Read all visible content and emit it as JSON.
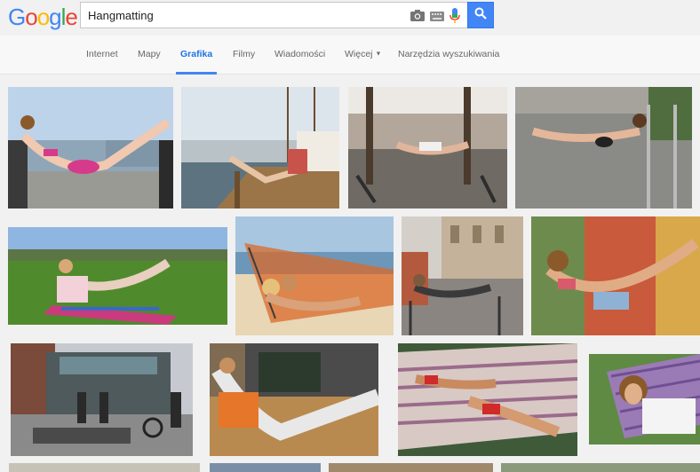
{
  "logo": {
    "letters": [
      "G",
      "o",
      "o",
      "g",
      "l",
      "e"
    ],
    "colors": [
      "#4285f4",
      "#ea4335",
      "#fbbc05",
      "#4285f4",
      "#34a853",
      "#ea4335"
    ]
  },
  "search": {
    "query": "Hangmatting",
    "icons": [
      "camera-icon",
      "keyboard-icon",
      "microphone-icon"
    ],
    "button_icon": "search-icon"
  },
  "tabs": [
    {
      "label": "Internet",
      "active": false
    },
    {
      "label": "Mapy",
      "active": false
    },
    {
      "label": "Grafika",
      "active": true
    },
    {
      "label": "Filmy",
      "active": false
    },
    {
      "label": "Wiadomości",
      "active": false
    },
    {
      "label": "Więcej",
      "active": false
    },
    {
      "label": "Narzędzia wyszukiwania",
      "active": false
    }
  ],
  "colors": {
    "accent": "#4285f4",
    "active_tab": "#1a73e8",
    "tab_text": "#666666"
  },
  "results": {
    "count": 16
  }
}
